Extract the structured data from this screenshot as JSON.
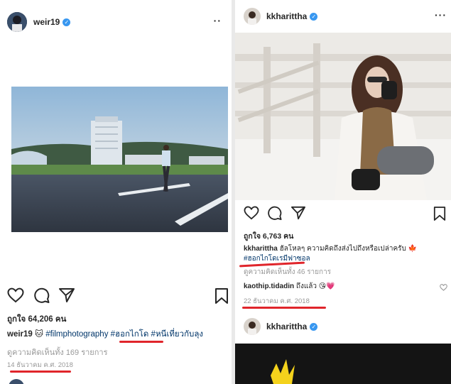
{
  "left_post": {
    "username": "weir19",
    "more_label": "··",
    "likes": "ถูกใจ 64,206 คน",
    "caption": {
      "user": "weir19",
      "emoji": "🐱",
      "hashtag1": "#filmphotography",
      "hashtag2": "#ฮอกไกโด",
      "hashtag3": "#หนีเที่ยวกับลุง"
    },
    "view_comments": "ดูความคิดเห็นทั้ง 169 รายการ",
    "date": "14 ธันวาคม ค.ศ. 2018"
  },
  "right_post": {
    "username": "kkharittha",
    "more_label": "···",
    "likes": "ถูกใจ 6,763 คน",
    "caption": {
      "user": "kkharittha",
      "text": "ฮัลโหลๆ ความคิดถึงส่งไปถึงหรือเปล่าครับ 🍁",
      "hashtag": "#ฮอกไกโดเรมีฟาซอล"
    },
    "view_comments": "ดูความคิดเห็นทั้ง 46 รายการ",
    "comment": {
      "user": "kaothip.tidadin",
      "text": "ถึงแล้ว 😘💗"
    },
    "date": "22 ธันวาคม ค.ศ. 2018"
  },
  "next_post": {
    "username": "kkharittha"
  },
  "colors": {
    "verified": "#3897f0",
    "hashtag": "#003569",
    "muted": "#999999",
    "underline": "#e0252b"
  }
}
